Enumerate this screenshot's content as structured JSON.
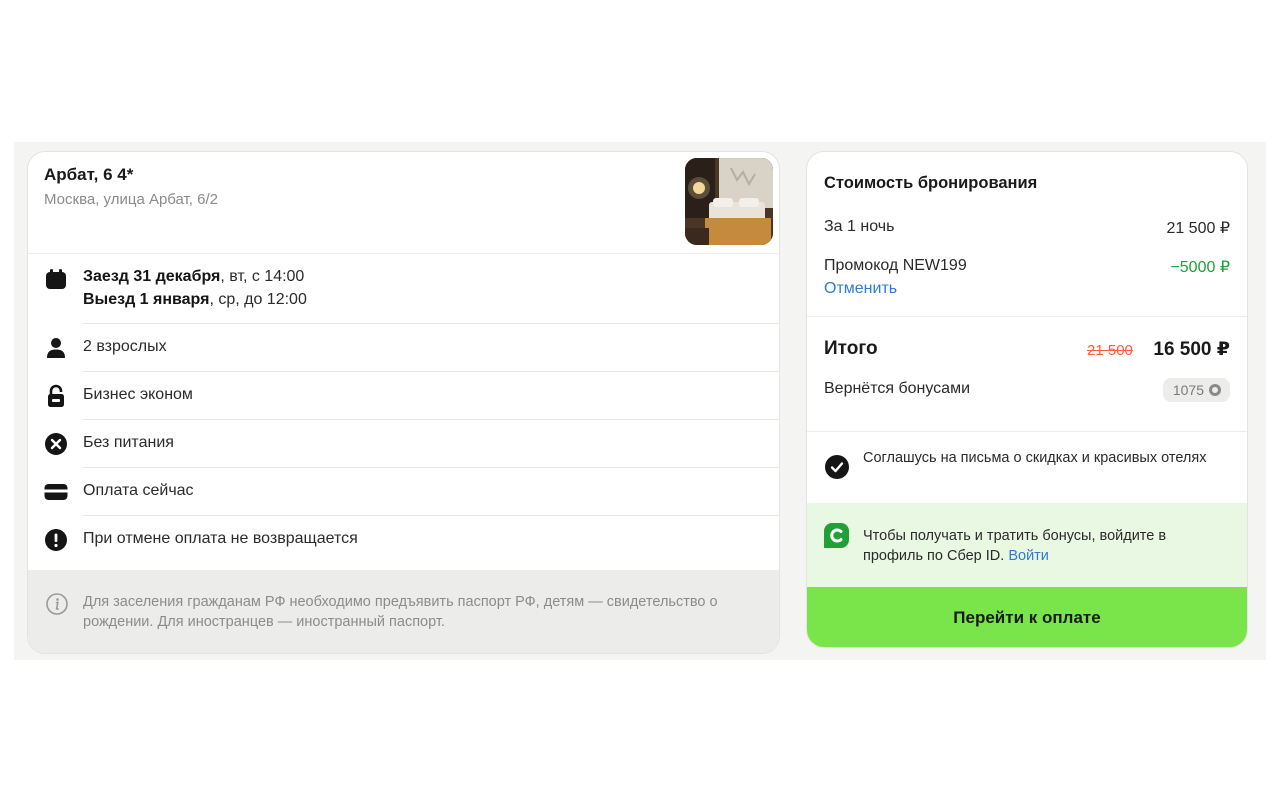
{
  "hotel": {
    "name": "Арбат, 6 4*",
    "address": "Москва, улица Арбат, 6/2"
  },
  "stay": {
    "checkin_bold": "Заезд 31 декабря",
    "checkin_rest": ", вт, с 14:00",
    "checkout_bold": "Выезд 1 января",
    "checkout_rest": ", ср, до 12:00"
  },
  "details": {
    "guests": "2 взрослых",
    "room": "Бизнес эконом",
    "meals": "Без питания",
    "payment": "Оплата сейчас",
    "cancellation": "При отмене оплата не возвращается"
  },
  "notice": "Для заселения гражданам РФ необходимо предъявить паспорт РФ, детям — свидетельство о рождении. Для иностранцев — иностранный паспорт.",
  "price": {
    "title": "Стоимость бронирования",
    "night_label": "За 1 ночь",
    "night_value": "21 500 ₽",
    "promo_label": "Промокод NEW199",
    "promo_value": "−5000 ₽",
    "cancel_promo": "Отменить",
    "total_label": "Итого",
    "old_price": "21 500",
    "total_value": "16 500 ₽",
    "bonus_label": "Вернётся бонусами",
    "bonus_value": "1075"
  },
  "agreement": "Соглашусь на письма о скидках и красивых отелях",
  "sber": {
    "text": "Чтобы получать и тратить бонусы, войдите в профиль по Сбер ID. ",
    "link": "Войти"
  },
  "pay_button": "Перейти к оплате",
  "colors": {
    "accent_green": "#79e54a",
    "promo_green": "#21a038",
    "link_blue": "#2f7bd6",
    "old_price_red": "#ff5a3c"
  },
  "icons": [
    "calendar-icon",
    "person-icon",
    "room-lock-icon",
    "no-meal-icon",
    "card-icon",
    "warning-icon",
    "info-icon",
    "check-icon",
    "sber-logo-icon",
    "ruble-coin-icon"
  ]
}
